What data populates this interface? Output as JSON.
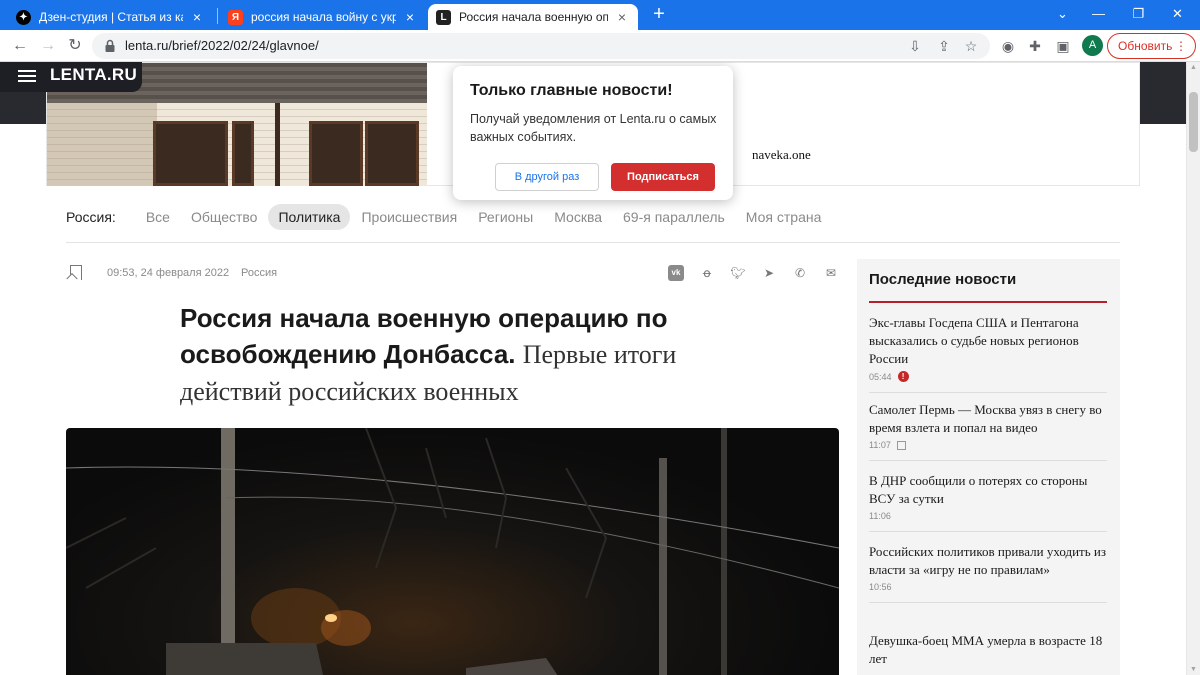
{
  "browser": {
    "tabs": [
      {
        "title": "Дзен-студия | Статья из картинс",
        "favicon": "zen-icon",
        "active": false
      },
      {
        "title": "россия начала войну с украино",
        "favicon": "yandex-icon",
        "active": false
      },
      {
        "title": "Россия начала военную операц",
        "favicon": "lenta-icon",
        "active": true
      }
    ],
    "url": "lenta.ru/brief/2022/02/24/glavnoe/",
    "avatar_letter": "A",
    "update_label": "Обновить",
    "favicon_letters": {
      "yandex": "Я",
      "lenta": "L"
    },
    "accent": "#1a73e8"
  },
  "site": {
    "logo": "LENTA.RU"
  },
  "banner": {
    "advertiser": "naveka.one"
  },
  "popup": {
    "title": "Только главные новости!",
    "text": "Получай уведомления от Lenta.ru о самых важных событиях.",
    "later": "В другой раз",
    "subscribe": "Подписаться"
  },
  "rubrics": {
    "label": "Россия:",
    "items": [
      "Все",
      "Общество",
      "Политика",
      "Происшествия",
      "Регионы",
      "Москва",
      "69-я параллель",
      "Моя страна"
    ],
    "active": "Политика"
  },
  "article": {
    "datetime": "09:53, 24 февраля 2022",
    "section": "Россия",
    "title": "Россия начала военную операцию по освобождению Донбасса.",
    "subtitle": "Первые итоги действий российских военных"
  },
  "sidebar": {
    "title": "Последние новости",
    "items": [
      {
        "text": "Экс-главы Госдепа США и Пентагона высказались о судьбе новых регионов России",
        "time": "05:44"
      },
      {
        "text": "Самолет Пермь — Москва увяз в снегу во время взлета и попал на видео",
        "time": "11:07"
      },
      {
        "text": "В ДНР сообщили о потерях со стороны ВСУ за сутки",
        "time": "11:06"
      },
      {
        "text": "Российских политиков привали уходить из власти за «игру не по правилам»",
        "time": "10:56"
      },
      {
        "text": "Девушка-боец ММА умерла в возрасте 18 лет",
        "time": ""
      }
    ]
  }
}
